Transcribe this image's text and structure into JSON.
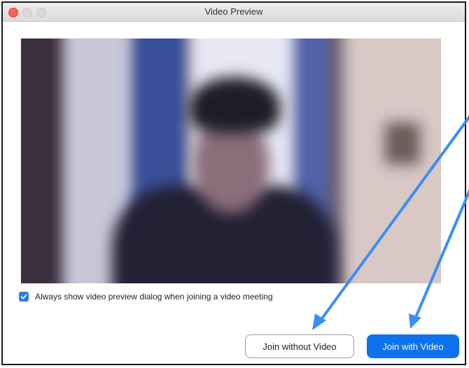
{
  "window": {
    "title": "Video Preview"
  },
  "preview": {
    "description_icon": "camera-preview"
  },
  "options": {
    "always_show_checked": true,
    "always_show_label": "Always show video preview dialog when joining a video meeting"
  },
  "buttons": {
    "join_without_video": "Join without Video",
    "join_with_video": "Join with Video"
  },
  "colors": {
    "primary": "#0e72ed",
    "checkbox": "#2f7bf5",
    "arrow": "#3b8df5",
    "close": "#fe5f57"
  }
}
